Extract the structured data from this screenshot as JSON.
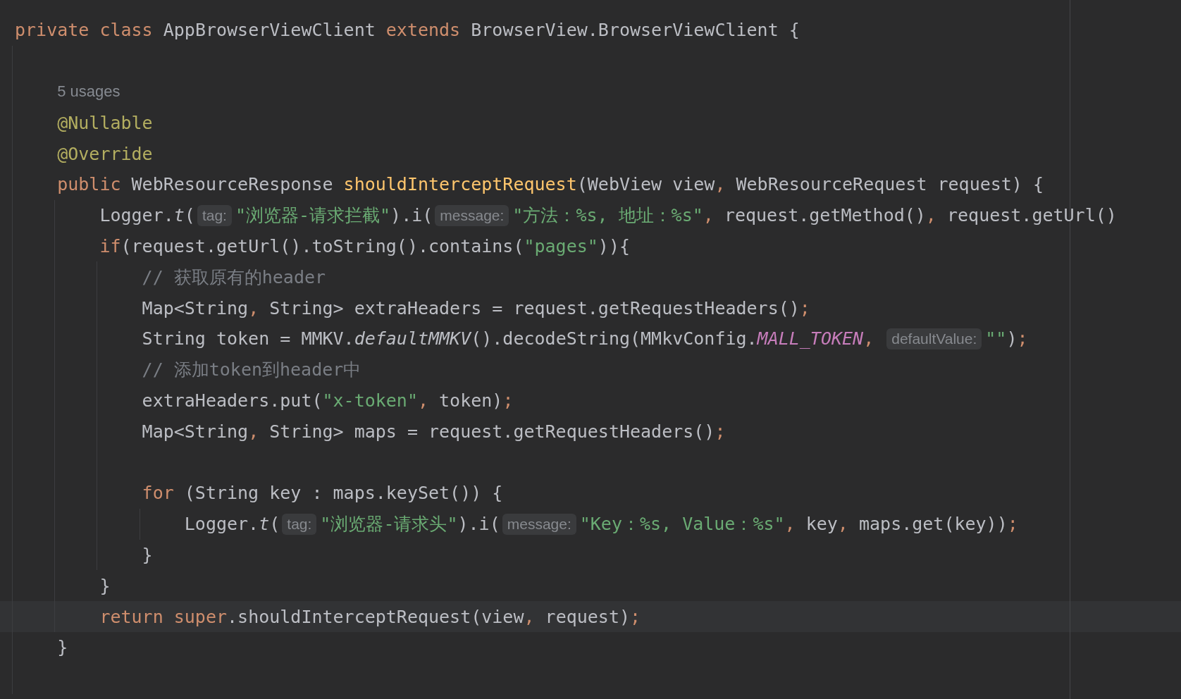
{
  "editor": {
    "lines": [
      {
        "kind": "code",
        "tokens": [
          {
            "kind": "kw",
            "text": "private class"
          },
          {
            "kind": "plain",
            "text": " AppBrowserViewClient "
          },
          {
            "kind": "kw",
            "text": "extends"
          },
          {
            "kind": "plain",
            "text": " BrowserView.BrowserViewClient {"
          }
        ]
      },
      {
        "kind": "block",
        "children": [
          {
            "kind": "blank"
          },
          {
            "kind": "code",
            "tokens": [
              {
                "kind": "usage",
                "text": "5 usages"
              }
            ]
          },
          {
            "kind": "code",
            "tokens": [
              {
                "kind": "ann",
                "text": "@Nullable"
              }
            ]
          },
          {
            "kind": "code",
            "tokens": [
              {
                "kind": "ann",
                "text": "@Override"
              }
            ]
          },
          {
            "kind": "code",
            "tokens": [
              {
                "kind": "kw",
                "text": "public"
              },
              {
                "kind": "plain",
                "text": " WebResourceResponse "
              },
              {
                "kind": "decl",
                "text": "shouldInterceptRequest"
              },
              {
                "kind": "plain",
                "text": "(WebView view"
              },
              {
                "kind": "punct",
                "text": ","
              },
              {
                "kind": "plain",
                "text": " WebResourceRequest request) {"
              }
            ]
          },
          {
            "kind": "block",
            "children": [
              {
                "kind": "code",
                "tokens": [
                  {
                    "kind": "plain",
                    "text": "Logger."
                  },
                  {
                    "kind": "static",
                    "text": "t"
                  },
                  {
                    "kind": "plain",
                    "text": "("
                  },
                  {
                    "kind": "hint",
                    "text": "tag:"
                  },
                  {
                    "kind": "str",
                    "text": "\"浏览器-请求拦截\""
                  },
                  {
                    "kind": "plain",
                    "text": ").i("
                  },
                  {
                    "kind": "hint",
                    "text": "message:"
                  },
                  {
                    "kind": "str",
                    "text": "\"方法：%s, 地址：%s\""
                  },
                  {
                    "kind": "punct",
                    "text": ","
                  },
                  {
                    "kind": "plain",
                    "text": " request.getMethod()"
                  },
                  {
                    "kind": "punct",
                    "text": ","
                  },
                  {
                    "kind": "plain",
                    "text": " request.getUrl()"
                  }
                ]
              },
              {
                "kind": "code",
                "tokens": [
                  {
                    "kind": "kw",
                    "text": "if"
                  },
                  {
                    "kind": "plain",
                    "text": "(request.getUrl().toString().contains("
                  },
                  {
                    "kind": "str",
                    "text": "\"pages\""
                  },
                  {
                    "kind": "plain",
                    "text": ")){"
                  }
                ]
              },
              {
                "kind": "block",
                "children": [
                  {
                    "kind": "code",
                    "tokens": [
                      {
                        "kind": "comment",
                        "text": "// 获取原有的header"
                      }
                    ]
                  },
                  {
                    "kind": "code",
                    "tokens": [
                      {
                        "kind": "plain",
                        "text": "Map<String"
                      },
                      {
                        "kind": "punct",
                        "text": ","
                      },
                      {
                        "kind": "plain",
                        "text": " String> extraHeaders = request.getRequestHeaders()"
                      },
                      {
                        "kind": "punct",
                        "text": ";"
                      }
                    ]
                  },
                  {
                    "kind": "code",
                    "tokens": [
                      {
                        "kind": "plain",
                        "text": "String token = MMKV."
                      },
                      {
                        "kind": "static",
                        "text": "defaultMMKV"
                      },
                      {
                        "kind": "plain",
                        "text": "().decodeString(MMkvConfig."
                      },
                      {
                        "kind": "field",
                        "text": "MALL_TOKEN"
                      },
                      {
                        "kind": "punct",
                        "text": ", "
                      },
                      {
                        "kind": "hint",
                        "text": "defaultValue:"
                      },
                      {
                        "kind": "str",
                        "text": "\"\""
                      },
                      {
                        "kind": "plain",
                        "text": ")"
                      },
                      {
                        "kind": "punct",
                        "text": ";"
                      }
                    ]
                  },
                  {
                    "kind": "code",
                    "tokens": [
                      {
                        "kind": "comment",
                        "text": "// 添加token到header中"
                      }
                    ]
                  },
                  {
                    "kind": "code",
                    "tokens": [
                      {
                        "kind": "plain",
                        "text": "extraHeaders.put("
                      },
                      {
                        "kind": "str",
                        "text": "\"x-token\""
                      },
                      {
                        "kind": "punct",
                        "text": ","
                      },
                      {
                        "kind": "plain",
                        "text": " token)"
                      },
                      {
                        "kind": "punct",
                        "text": ";"
                      }
                    ]
                  },
                  {
                    "kind": "code",
                    "tokens": [
                      {
                        "kind": "plain",
                        "text": "Map<String"
                      },
                      {
                        "kind": "punct",
                        "text": ","
                      },
                      {
                        "kind": "plain",
                        "text": " String> maps = request.getRequestHeaders()"
                      },
                      {
                        "kind": "punct",
                        "text": ";"
                      }
                    ]
                  },
                  {
                    "kind": "blank"
                  },
                  {
                    "kind": "code",
                    "tokens": [
                      {
                        "kind": "kw",
                        "text": "for"
                      },
                      {
                        "kind": "plain",
                        "text": " (String key : maps.keySet()) {"
                      }
                    ]
                  },
                  {
                    "kind": "block",
                    "children": [
                      {
                        "kind": "code",
                        "tokens": [
                          {
                            "kind": "plain",
                            "text": "Logger."
                          },
                          {
                            "kind": "static",
                            "text": "t"
                          },
                          {
                            "kind": "plain",
                            "text": "("
                          },
                          {
                            "kind": "hint",
                            "text": "tag:"
                          },
                          {
                            "kind": "str",
                            "text": "\"浏览器-请求头\""
                          },
                          {
                            "kind": "plain",
                            "text": ").i("
                          },
                          {
                            "kind": "hint",
                            "text": "message:"
                          },
                          {
                            "kind": "str",
                            "text": "\"Key：%s, Value：%s\""
                          },
                          {
                            "kind": "punct",
                            "text": ","
                          },
                          {
                            "kind": "plain",
                            "text": " key"
                          },
                          {
                            "kind": "punct",
                            "text": ","
                          },
                          {
                            "kind": "plain",
                            "text": " maps.get(key))"
                          },
                          {
                            "kind": "punct",
                            "text": ";"
                          }
                        ]
                      }
                    ]
                  },
                  {
                    "kind": "code",
                    "tokens": [
                      {
                        "kind": "plain",
                        "text": "}"
                      }
                    ]
                  }
                ]
              },
              {
                "kind": "code",
                "tokens": [
                  {
                    "kind": "plain",
                    "text": "}"
                  }
                ]
              },
              {
                "kind": "code",
                "current": true,
                "tokens": [
                  {
                    "kind": "kw",
                    "text": "return super"
                  },
                  {
                    "kind": "plain",
                    "text": ".shouldInterceptRequest(view"
                  },
                  {
                    "kind": "punct",
                    "text": ","
                  },
                  {
                    "kind": "plain",
                    "text": " request)"
                  },
                  {
                    "kind": "punct",
                    "text": ";"
                  }
                ]
              }
            ]
          },
          {
            "kind": "code",
            "tokens": [
              {
                "kind": "plain",
                "text": "}"
              }
            ]
          },
          {
            "kind": "blank"
          }
        ]
      }
    ]
  }
}
